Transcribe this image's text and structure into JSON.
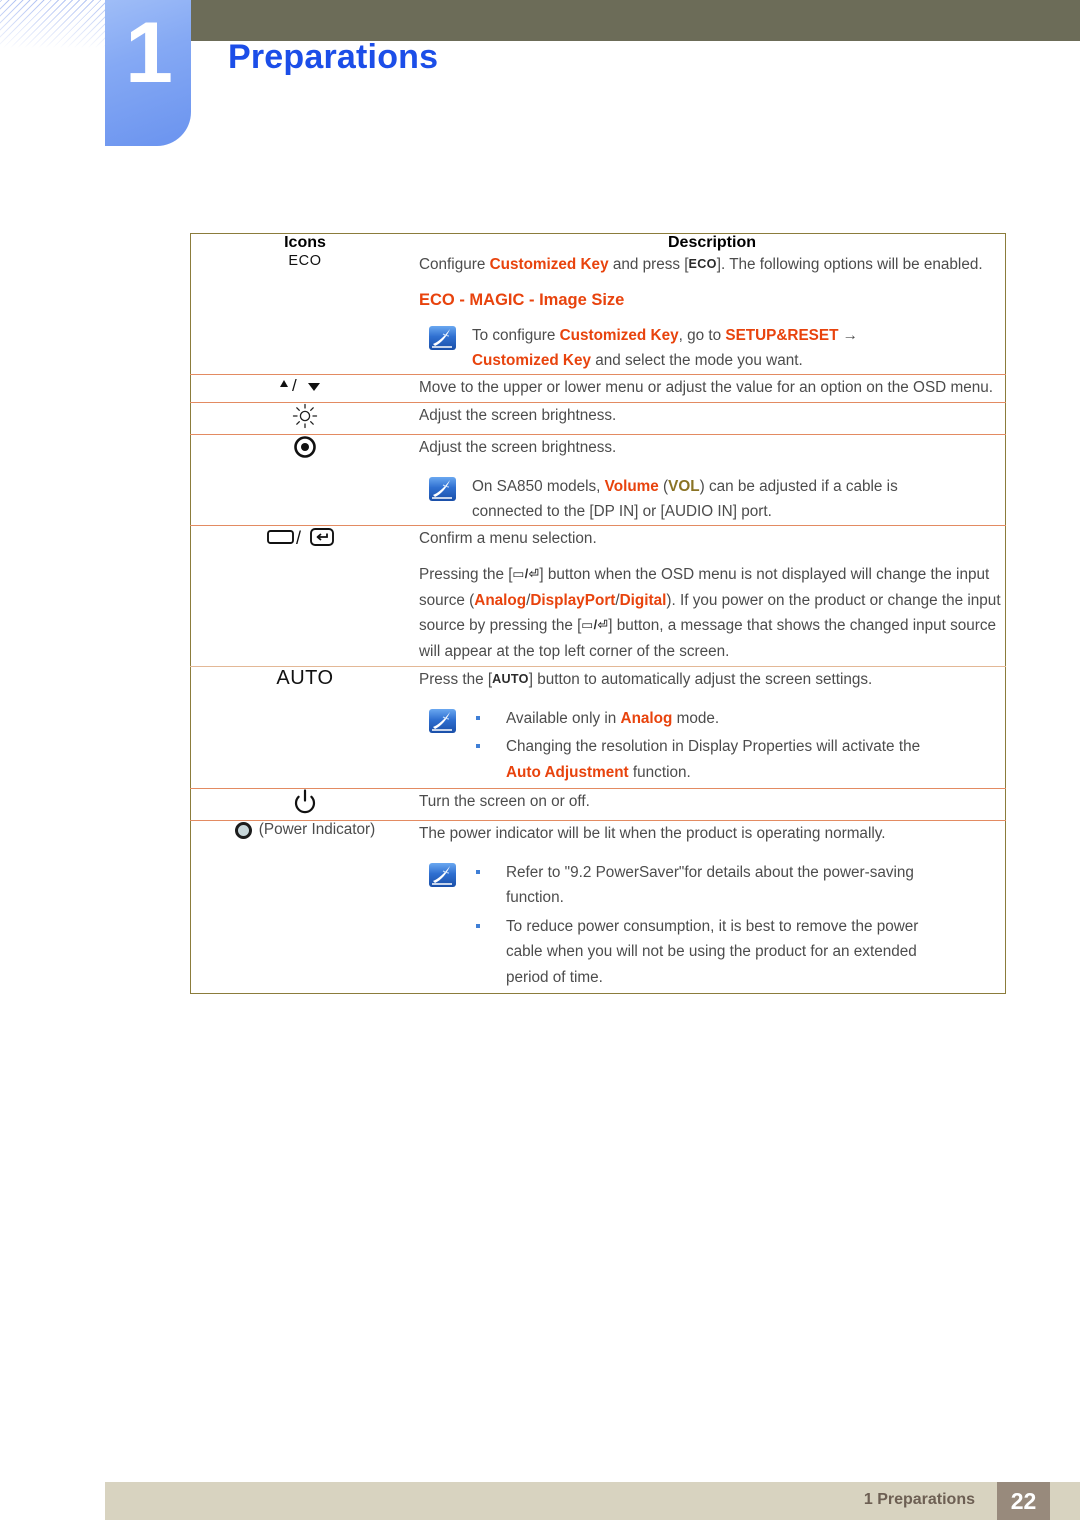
{
  "header": {
    "chapter_number": "1",
    "title": "Preparations",
    "accent_blue": "#1c4ee8",
    "tab_blue": "#85a9f4",
    "bar_olive": "#6c6c58"
  },
  "table": {
    "columns": [
      "Icons",
      "Description"
    ],
    "rows": [
      {
        "icon_name": "eco-button",
        "icon_glyph": "ECO",
        "blocks": [
          {
            "type": "paragraph",
            "segments": [
              {
                "text": "Configure ",
                "style": "normal"
              },
              {
                "text": "Customized Key",
                "style": "red"
              },
              {
                "text": " and press [",
                "style": "normal"
              },
              {
                "text": "ECO",
                "style": "kbd"
              },
              {
                "text": "]. The following options will be enabled.",
                "style": "normal"
              }
            ]
          },
          {
            "type": "redhead",
            "text": "ECO - MAGIC - Image Size"
          },
          {
            "type": "note",
            "lines": [
              {
                "segments": [
                  {
                    "text": "To configure ",
                    "style": "normal"
                  },
                  {
                    "text": "Customized Key",
                    "style": "red"
                  },
                  {
                    "text": ", go to ",
                    "style": "normal"
                  },
                  {
                    "text": "SETUP&RESET",
                    "style": "red"
                  },
                  {
                    "text": "  →",
                    "style": "normal"
                  }
                ]
              },
              {
                "segments": [
                  {
                    "text": "Customized Key",
                    "style": "red"
                  },
                  {
                    "text": " and select the mode you want.",
                    "style": "normal"
                  }
                ]
              }
            ]
          }
        ]
      },
      {
        "icon_name": "up-down-arrow-button",
        "icon_glyph": "▲/▼",
        "blocks": [
          {
            "type": "paragraph",
            "segments": [
              {
                "text": "Move to the upper or lower menu or adjust the value for an option on the OSD menu.",
                "style": "normal"
              }
            ]
          }
        ]
      },
      {
        "icon_name": "brightness-button",
        "icon_glyph": "☼",
        "blocks": [
          {
            "type": "paragraph",
            "segments": [
              {
                "text": "Adjust the screen brightness.",
                "style": "normal"
              }
            ]
          }
        ]
      },
      {
        "icon_name": "volume-button",
        "icon_glyph": "◉",
        "blocks": [
          {
            "type": "paragraph",
            "segments": [
              {
                "text": "Adjust the screen brightness.",
                "style": "normal"
              }
            ]
          },
          {
            "type": "note",
            "lines": [
              {
                "segments": [
                  {
                    "text": "On SA850 models, ",
                    "style": "normal"
                  },
                  {
                    "text": "Volume",
                    "style": "red"
                  },
                  {
                    "text": " (",
                    "style": "normal"
                  },
                  {
                    "text": "VOL",
                    "style": "olive"
                  },
                  {
                    "text": ") can be adjusted if a cable is",
                    "style": "normal"
                  }
                ]
              },
              {
                "segments": [
                  {
                    "text": "connected to the [DP IN] or [AUDIO IN] port.",
                    "style": "normal"
                  }
                ]
              }
            ]
          }
        ]
      },
      {
        "icon_name": "enter-menu-button",
        "icon_glyph": "▭/⏎",
        "blocks": [
          {
            "type": "paragraph",
            "segments": [
              {
                "text": "Confirm a menu selection.",
                "style": "normal"
              }
            ]
          },
          {
            "type": "paragraph",
            "segments": [
              {
                "text": "Pressing the [",
                "style": "normal"
              },
              {
                "text": "▭/⏎",
                "style": "kbd"
              },
              {
                "text": "] button when the OSD menu is not displayed will change the input source (",
                "style": "normal"
              },
              {
                "text": "Analog",
                "style": "red"
              },
              {
                "text": "/",
                "style": "normal"
              },
              {
                "text": "DisplayPort",
                "style": "red"
              },
              {
                "text": "/",
                "style": "normal"
              },
              {
                "text": "Digital",
                "style": "red"
              },
              {
                "text": "). If you power on the product or change the input source by pressing the [",
                "style": "normal"
              },
              {
                "text": "▭/⏎",
                "style": "kbd"
              },
              {
                "text": "] button, a message that shows the changed input source will appear at the top left corner of the screen.",
                "style": "normal"
              }
            ]
          }
        ]
      },
      {
        "icon_name": "auto-button",
        "icon_glyph": "AUTO",
        "blocks": [
          {
            "type": "paragraph",
            "segments": [
              {
                "text": "Press the [",
                "style": "normal"
              },
              {
                "text": "AUTO",
                "style": "kbd"
              },
              {
                "text": "] button to automatically adjust the screen settings.",
                "style": "normal"
              }
            ]
          },
          {
            "type": "note-bullets",
            "bullets": [
              {
                "lines": [
                  {
                    "segments": [
                      {
                        "text": "Available only in ",
                        "style": "normal"
                      },
                      {
                        "text": "Analog",
                        "style": "red"
                      },
                      {
                        "text": " mode.",
                        "style": "normal"
                      }
                    ]
                  }
                ]
              },
              {
                "lines": [
                  {
                    "segments": [
                      {
                        "text": "Changing the resolution in Display Properties will activate the",
                        "style": "normal"
                      }
                    ]
                  },
                  {
                    "segments": [
                      {
                        "text": "Auto Adjustment",
                        "style": "red"
                      },
                      {
                        "text": " function.",
                        "style": "normal"
                      }
                    ]
                  }
                ]
              }
            ]
          }
        ]
      },
      {
        "icon_name": "power-button",
        "icon_glyph": "⏻",
        "blocks": [
          {
            "type": "paragraph",
            "segments": [
              {
                "text": "Turn the screen on or off.",
                "style": "normal"
              }
            ]
          }
        ]
      },
      {
        "icon_name": "power-indicator",
        "icon_glyph": "●",
        "icon_label": "(Power Indicator)",
        "blocks": [
          {
            "type": "paragraph",
            "segments": [
              {
                "text": "The power indicator will be lit when the product is operating normally.",
                "style": "normal"
              }
            ]
          },
          {
            "type": "note-bullets",
            "bullets": [
              {
                "lines": [
                  {
                    "segments": [
                      {
                        "text": "Refer to \"9.2 PowerSaver\"for details about the power-saving",
                        "style": "normal"
                      }
                    ]
                  },
                  {
                    "segments": [
                      {
                        "text": "function.",
                        "style": "normal"
                      }
                    ]
                  }
                ]
              },
              {
                "lines": [
                  {
                    "segments": [
                      {
                        "text": "To reduce power consumption, it is best to remove the power",
                        "style": "normal"
                      }
                    ]
                  },
                  {
                    "segments": [
                      {
                        "text": "cable when you will not be using the product for an extended",
                        "style": "normal"
                      }
                    ]
                  },
                  {
                    "segments": [
                      {
                        "text": "period of time.",
                        "style": "normal"
                      }
                    ]
                  }
                ]
              }
            ]
          }
        ]
      }
    ]
  },
  "footer": {
    "chapter_label": "1 Preparations",
    "page_number": "22"
  }
}
